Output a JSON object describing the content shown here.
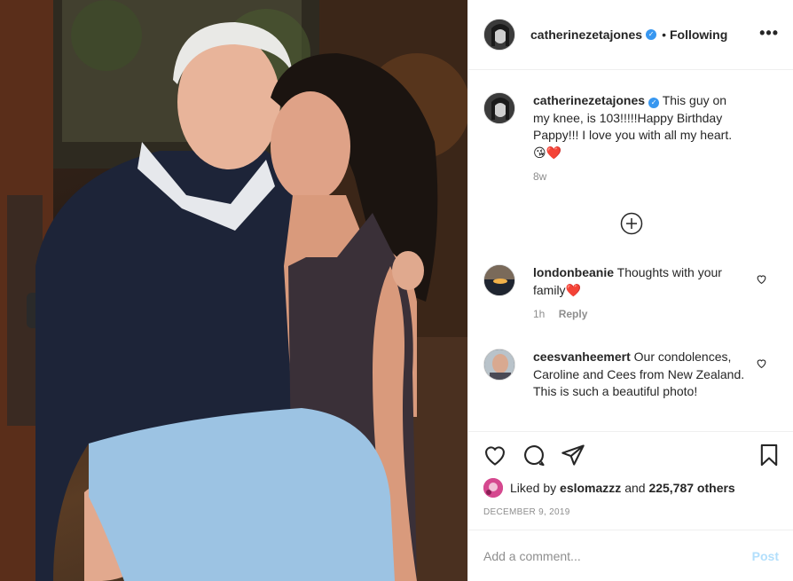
{
  "header": {
    "username": "catherinezetajones",
    "separator": "•",
    "follow_status": "Following",
    "more_label": "•••"
  },
  "caption": {
    "username": "catherinezetajones",
    "text": "This guy on my knee, is 103!!!!!Happy Birthday Pappy!!! I love you with all my heart.",
    "emoji": "😘❤️",
    "age": "8w"
  },
  "comments": [
    {
      "username": "londonbeanie",
      "text": "Thoughts with your family",
      "emoji": "❤️",
      "age": "1h",
      "reply_label": "Reply"
    },
    {
      "username": "ceesvanheemert",
      "text": "Our condolences, Caroline and Cees from New Zealand. This is such a beautiful photo!"
    }
  ],
  "likes": {
    "prefix": "Liked by",
    "liker": "eslomazzz",
    "conjunction": "and",
    "others": "225,787 others"
  },
  "date": "DECEMBER 9, 2019",
  "add_comment": {
    "placeholder": "Add a comment...",
    "post_label": "Post"
  },
  "colors": {
    "verified": "#3897f0",
    "post_button": "#b2dffc",
    "muted": "#8e8e8e"
  }
}
